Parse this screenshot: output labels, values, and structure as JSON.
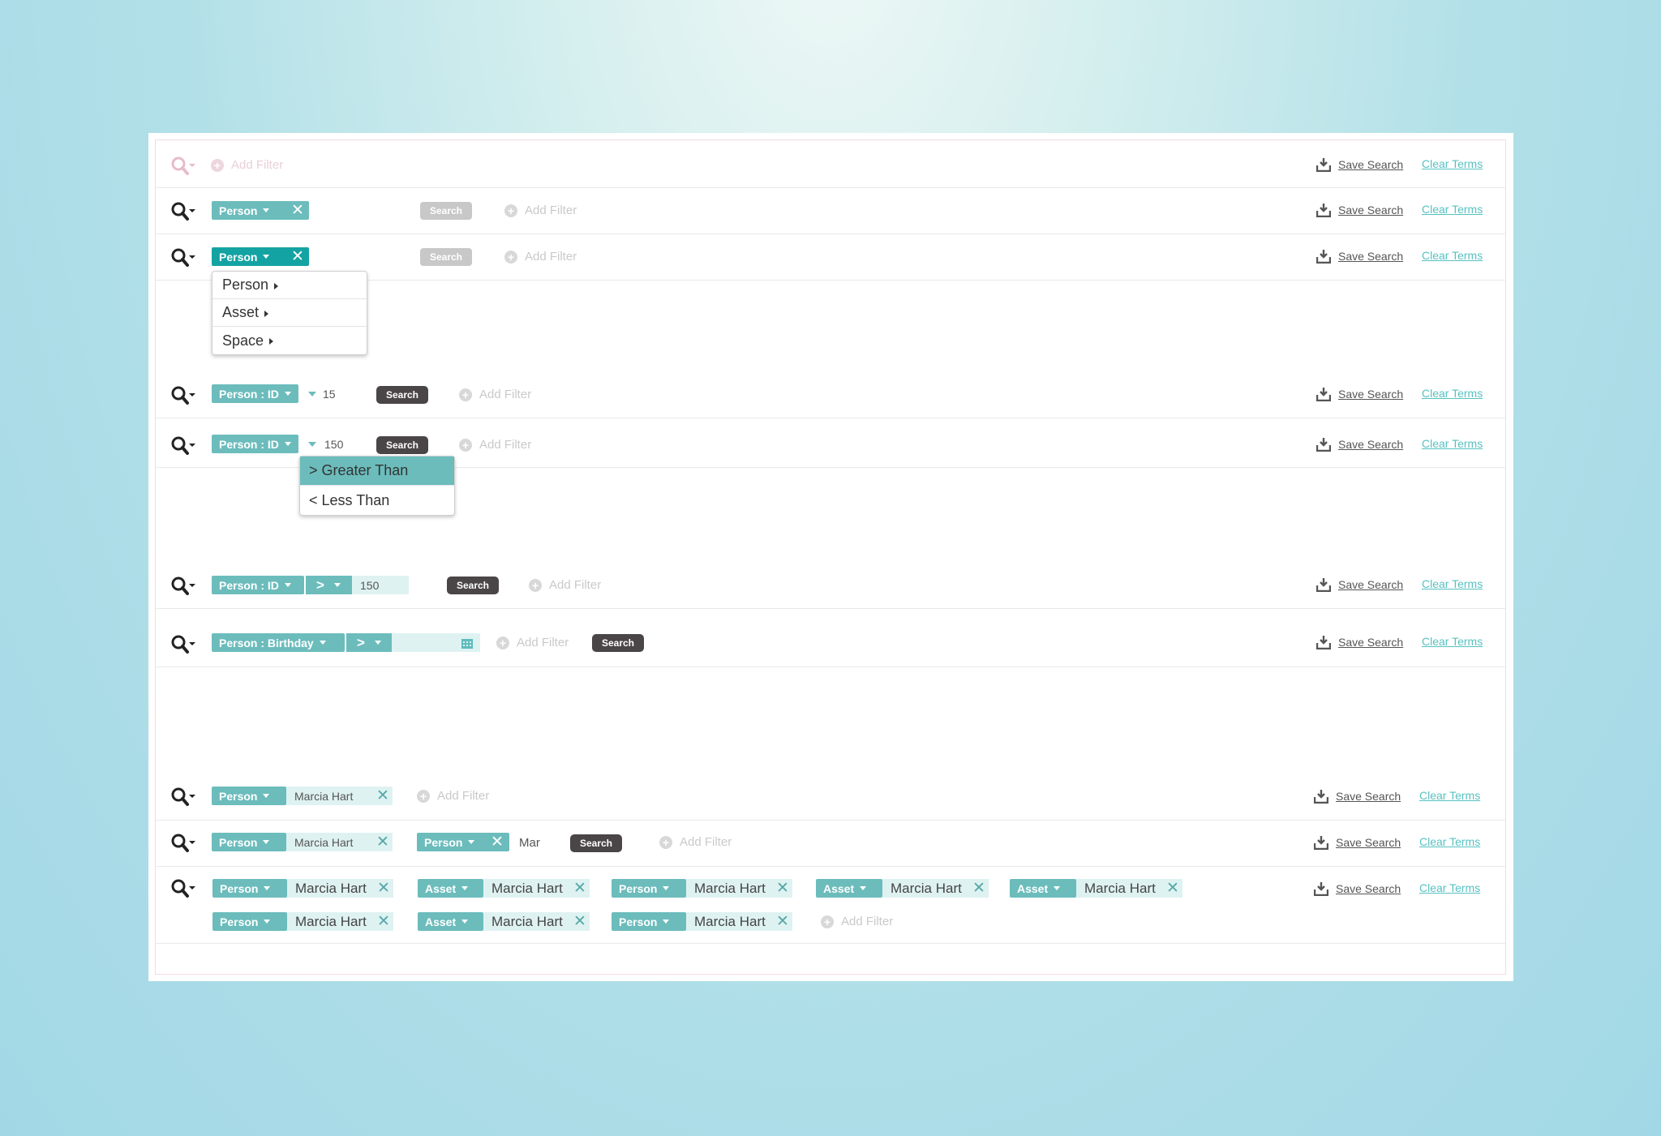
{
  "common": {
    "add_filter": "Add Filter",
    "save_search": "Save Search",
    "clear_terms": "Clear Terms",
    "search": "Search",
    "close_glyph": "✕"
  },
  "tags": {
    "person": "Person",
    "asset": "Asset",
    "person_id": "Person : ID",
    "person_birthday": "Person : Birthday"
  },
  "type_menu": {
    "items": [
      "Person",
      "Asset",
      "Space"
    ]
  },
  "operator_menu": {
    "items": [
      "> Greater Than",
      "< Less Than"
    ],
    "selected_index": 0
  },
  "operator_symbol": ">",
  "values": {
    "id_short": "15",
    "id_full": "150",
    "name": "Marcia Hart",
    "partial": "Mar"
  },
  "multi_row": [
    {
      "type": "Person",
      "value": "Marcia Hart"
    },
    {
      "type": "Asset",
      "value": "Marcia Hart"
    },
    {
      "type": "Person",
      "value": "Marcia Hart"
    },
    {
      "type": "Asset",
      "value": "Marcia Hart"
    },
    {
      "type": "Asset",
      "value": "Marcia Hart"
    },
    {
      "type": "Person",
      "value": "Marcia Hart"
    },
    {
      "type": "Asset",
      "value": "Marcia Hart"
    },
    {
      "type": "Person",
      "value": "Marcia Hart"
    }
  ],
  "colors": {
    "tag": "#6cbcbc",
    "tag_active": "#14a3a3",
    "value_bg": "#dff2f2",
    "search_button": "#4a4546",
    "link": "#57c1c1"
  }
}
